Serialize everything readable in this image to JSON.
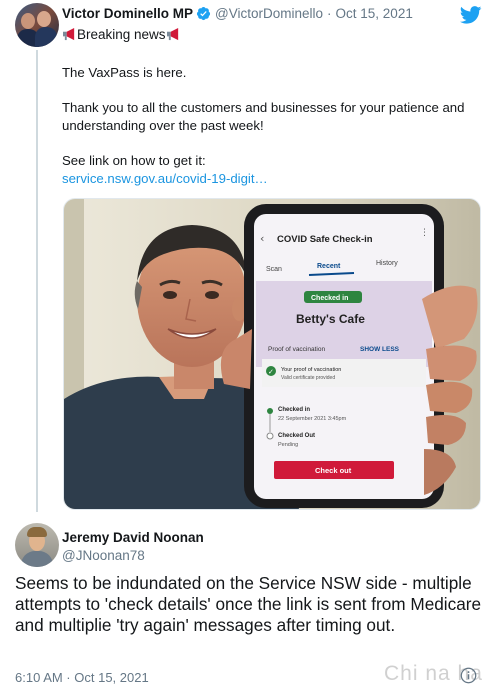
{
  "tweet": {
    "author_name": "Victor Dominello MP",
    "handle": "@VictorDominello",
    "separator": "·",
    "date": "Oct 15, 2021",
    "line1": "Breaking news",
    "paragraph1": "The VaxPass is here.",
    "paragraph2": "Thank you to all the customers and businesses for your patience and understanding over the past week!",
    "paragraph3": "See link on how to get it:",
    "link": "service.nsw.gov.au/covid-19-digit…",
    "icons": [
      "verified-badge-icon",
      "megaphone-icon",
      "twitter-bird-icon"
    ],
    "image": {
      "app_title": "COVID Safe Check-in",
      "tabs": [
        "Scan",
        "Recent",
        "History"
      ],
      "checked_in_badge": "Checked in",
      "venue": "Betty's Cafe",
      "proof_label": "Proof of vaccination",
      "show_less": "SHOW LESS",
      "proof_title": "Your proof of vaccination",
      "proof_sub": "Valid certificate provided",
      "checked_in_label": "Checked in",
      "checked_in_time": "22 September 2021 3:45pm",
      "checked_out_label": "Checked Out",
      "checked_out_status": "Pending",
      "checkout_button": "Check out"
    }
  },
  "reply": {
    "author_name": "Jeremy David Noonan",
    "handle": "@JNoonan78",
    "text": "Seems to be indundated on the Service NSW side - multiple attempts to 'check details' once the link is sent from Medicare and multiplie 'try again' messages after timing out.",
    "timestamp": "6:10 AM · Oct 15, 2021",
    "watermark": "Chi  na  ha"
  },
  "colors": {
    "link": "#1b95e0",
    "twitter_blue": "#1da1f2",
    "muted": "#657786",
    "accent_red": "#d01a3a"
  }
}
